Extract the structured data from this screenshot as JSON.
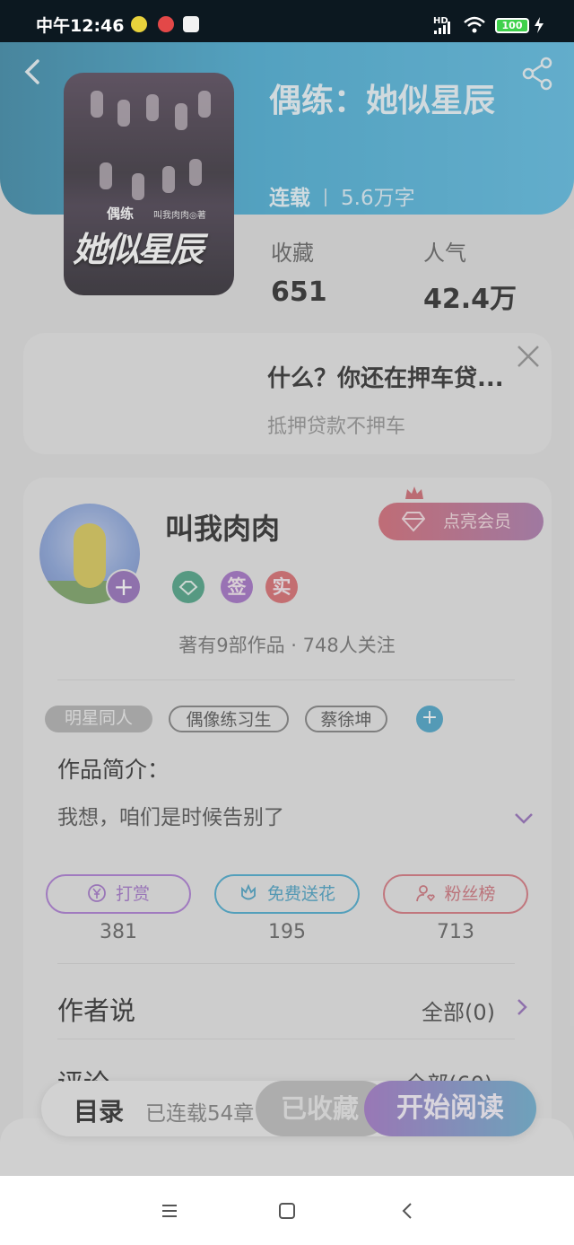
{
  "status_bar": {
    "time": "中午12:46",
    "network": "HD",
    "battery": "100"
  },
  "book": {
    "title": "偶练：她似星辰",
    "cover_stamp": "偶练",
    "cover_author": "叫我肉肉◎著",
    "cover_title": "她似星辰",
    "serial_status": "连载",
    "word_count": "5.6万字",
    "favorites_label": "收藏",
    "favorites_value": "651",
    "popularity_label": "人气",
    "popularity_value": "42.4万"
  },
  "ad": {
    "headline": "什么？你还在押车贷...",
    "sub": "抵押贷款不押车"
  },
  "author": {
    "name": "叫我肉肉",
    "vip_button": "点亮会员",
    "badges": [
      "签",
      "实"
    ],
    "works_line": "著有9部作品 · 748人关注"
  },
  "tags": [
    "明星同人",
    "偶像练习生",
    "蔡徐坤"
  ],
  "intro": {
    "title": "作品简介：",
    "text": "我想，咱们是时候告别了"
  },
  "actions": [
    {
      "label": "打赏",
      "count": "381",
      "color": "#a46fcf"
    },
    {
      "label": "免费送花",
      "count": "195",
      "color": "#3aa3c9"
    },
    {
      "label": "粉丝榜",
      "count": "713",
      "color": "#d16a74"
    }
  ],
  "author_says": {
    "label": "作者说",
    "right": "全部(0)"
  },
  "comments": {
    "label": "评论",
    "right": "全部(60)"
  },
  "bottom_bar": {
    "toc": "目录",
    "toc_sub": "已连载54章",
    "fav_button": "已收藏",
    "read_button": "开始阅读"
  },
  "icons": {
    "back": "back-arrow-icon",
    "share": "share-icon",
    "close": "close-icon",
    "gem": "diamond-icon",
    "crown": "crown-icon",
    "expand": "chevron-down-icon"
  },
  "colors": {
    "hero": "#3aa6d0",
    "accent_purple": "#8c63b4",
    "vip": "#cf5d6a"
  }
}
